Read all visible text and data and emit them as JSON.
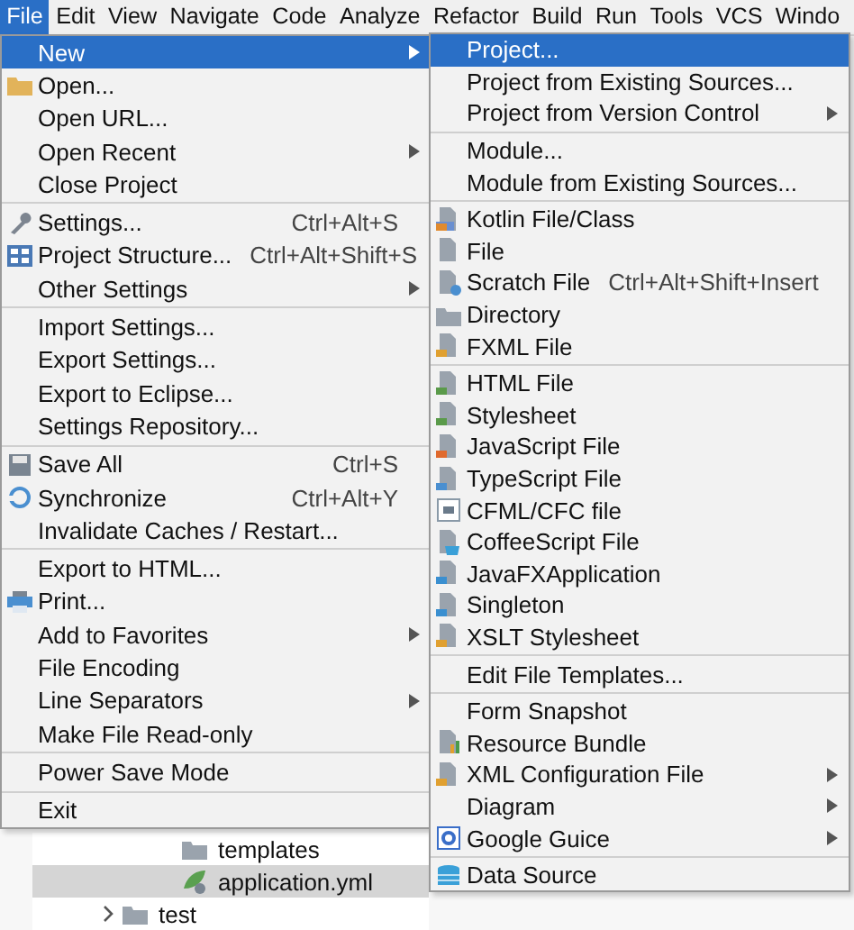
{
  "menubar": [
    {
      "label": "File",
      "selected": true
    },
    {
      "label": "Edit",
      "selected": false
    },
    {
      "label": "View",
      "selected": false
    },
    {
      "label": "Navigate",
      "selected": false
    },
    {
      "label": "Code",
      "selected": false
    },
    {
      "label": "Analyze",
      "selected": false
    },
    {
      "label": "Refactor",
      "selected": false
    },
    {
      "label": "Build",
      "selected": false
    },
    {
      "label": "Run",
      "selected": false
    },
    {
      "label": "Tools",
      "selected": false
    },
    {
      "label": "VCS",
      "selected": false
    },
    {
      "label": "Windo",
      "selected": false
    }
  ],
  "file_menu": [
    {
      "kind": "plain",
      "label": "New",
      "selected": true,
      "submenu": true
    },
    {
      "kind": "folder",
      "label": "Open...",
      "selected": false
    },
    {
      "kind": "plain",
      "label": "Open URL...",
      "selected": false
    },
    {
      "kind": "plain",
      "label": "Open Recent",
      "selected": false,
      "submenu": true
    },
    {
      "kind": "plain",
      "label": "Close Project",
      "selected": false
    },
    {
      "kind": "separator"
    },
    {
      "kind": "wrench",
      "label": "Settings...",
      "shortcut": "Ctrl+Alt+S",
      "selected": false
    },
    {
      "kind": "grid",
      "label": "Project Structure...",
      "shortcut": "Ctrl+Alt+Shift+S",
      "selected": false
    },
    {
      "kind": "plain",
      "label": "Other Settings",
      "selected": false,
      "submenu": true
    },
    {
      "kind": "separator"
    },
    {
      "kind": "plain",
      "label": "Import Settings...",
      "selected": false
    },
    {
      "kind": "plain",
      "label": "Export Settings...",
      "selected": false
    },
    {
      "kind": "plain",
      "label": "Export to Eclipse...",
      "selected": false
    },
    {
      "kind": "plain",
      "label": "Settings Repository...",
      "selected": false
    },
    {
      "kind": "separator"
    },
    {
      "kind": "disk",
      "label": "Save All",
      "shortcut": "Ctrl+S",
      "selected": false
    },
    {
      "kind": "sync",
      "label": "Synchronize",
      "shortcut": "Ctrl+Alt+Y",
      "selected": false
    },
    {
      "kind": "plain",
      "label": "Invalidate Caches / Restart...",
      "selected": false
    },
    {
      "kind": "separator"
    },
    {
      "kind": "plain",
      "label": "Export to HTML...",
      "selected": false
    },
    {
      "kind": "printer",
      "label": "Print...",
      "selected": false
    },
    {
      "kind": "plain",
      "label": "Add to Favorites",
      "selected": false,
      "submenu": true
    },
    {
      "kind": "plain",
      "label": "File Encoding",
      "selected": false
    },
    {
      "kind": "plain",
      "label": "Line Separators",
      "selected": false,
      "submenu": true
    },
    {
      "kind": "plain",
      "label": "Make File Read-only",
      "selected": false
    },
    {
      "kind": "separator"
    },
    {
      "kind": "plain",
      "label": "Power Save Mode",
      "selected": false
    },
    {
      "kind": "separator"
    },
    {
      "kind": "plain",
      "label": "Exit",
      "selected": false
    }
  ],
  "new_submenu": [
    {
      "kind": "plain",
      "label": "Project...",
      "selected": true
    },
    {
      "kind": "plain",
      "label": "Project from Existing Sources...",
      "selected": false
    },
    {
      "kind": "plain",
      "label": "Project from Version Control",
      "selected": false,
      "submenu": true
    },
    {
      "kind": "separator"
    },
    {
      "kind": "plain",
      "label": "Module...",
      "selected": false
    },
    {
      "kind": "plain",
      "label": "Module from Existing Sources...",
      "selected": false
    },
    {
      "kind": "separator"
    },
    {
      "kind": "kotlin",
      "label": "Kotlin File/Class",
      "selected": false
    },
    {
      "kind": "file",
      "label": "File",
      "selected": false
    },
    {
      "kind": "scratch",
      "label": "Scratch File",
      "shortcut": "Ctrl+Alt+Shift+Insert",
      "selected": false
    },
    {
      "kind": "directory",
      "label": "Directory",
      "selected": false
    },
    {
      "kind": "markup",
      "label": "FXML File",
      "selected": false
    },
    {
      "kind": "separator"
    },
    {
      "kind": "html",
      "label": "HTML File",
      "selected": false
    },
    {
      "kind": "css",
      "label": "Stylesheet",
      "selected": false
    },
    {
      "kind": "js",
      "label": "JavaScript File",
      "selected": false
    },
    {
      "kind": "ts",
      "label": "TypeScript File",
      "selected": false
    },
    {
      "kind": "cf",
      "label": "CFML/CFC file",
      "selected": false
    },
    {
      "kind": "coffee",
      "label": "CoffeeScript File",
      "selected": false
    },
    {
      "kind": "java",
      "label": "JavaFXApplication",
      "selected": false
    },
    {
      "kind": "java",
      "label": "Singleton",
      "selected": false
    },
    {
      "kind": "markup",
      "label": "XSLT Stylesheet",
      "selected": false
    },
    {
      "kind": "separator"
    },
    {
      "kind": "plain",
      "label": "Edit File Templates...",
      "selected": false
    },
    {
      "kind": "separator"
    },
    {
      "kind": "plain",
      "label": "Form Snapshot",
      "selected": false
    },
    {
      "kind": "bundle",
      "label": "Resource Bundle",
      "selected": false
    },
    {
      "kind": "markup",
      "label": "XML Configuration File",
      "selected": false,
      "submenu": true
    },
    {
      "kind": "plain",
      "label": "Diagram",
      "selected": false,
      "submenu": true
    },
    {
      "kind": "guice",
      "label": "Google Guice",
      "selected": false,
      "submenu": true
    },
    {
      "kind": "separator"
    },
    {
      "kind": "database",
      "label": "Data Source",
      "selected": false
    }
  ],
  "project_tree": [
    {
      "children": [
        {
          "kind": "directory",
          "label": "templates",
          "selected": false
        },
        {
          "kind": "yaml",
          "label": "application.yml",
          "selected": true
        }
      ]
    },
    {
      "kind": "directory",
      "label": "test",
      "expanded": false,
      "selected": false
    }
  ]
}
